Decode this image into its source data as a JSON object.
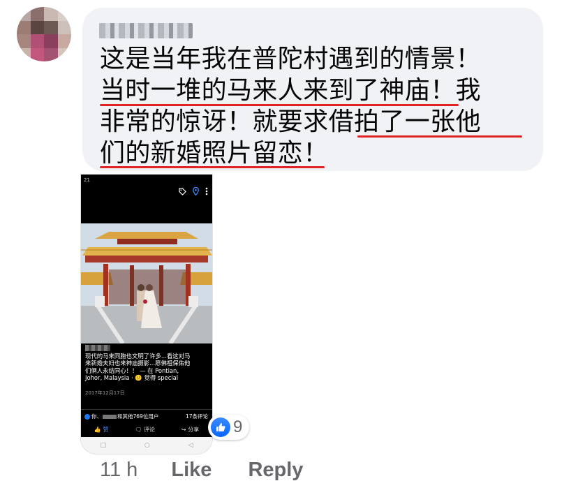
{
  "comment": {
    "author_name": "",
    "lines": [
      "这是当年我在普陀村遇到的情景！",
      "当时一堆的马来人来到了神庙！我",
      "非常的惊讶！就要求借拍了一张他",
      "们的新婚照片留恋！"
    ],
    "underline_color": "#e02424"
  },
  "attachment": {
    "status_time": "21",
    "icons": [
      "tag-icon",
      "location-pin-icon",
      "more-vertical-icon"
    ],
    "caption_lines": [
      "现代的马来同胞也文明了许多...看这对马",
      "来新婚夫妇也来神庙摄影...愿佛祖保佑他",
      "们俩人永结同心！！ — 在 Pontian,",
      "Johor, Malaysia · 🙂 觉得 special"
    ],
    "date": "2017年12月17日",
    "stats_left_prefix": "你、",
    "stats_left_suffix": "和其他769位用户",
    "stats_right": "17条评论",
    "actions": {
      "like": "赞",
      "comment": "评论",
      "share": "分享"
    },
    "nav": [
      "□",
      "○",
      "◁"
    ]
  },
  "reaction": {
    "count": "9",
    "type": "like",
    "color": "#0866ff"
  },
  "meta": {
    "time": "11 h",
    "like_label": "Like",
    "reply_label": "Reply"
  }
}
